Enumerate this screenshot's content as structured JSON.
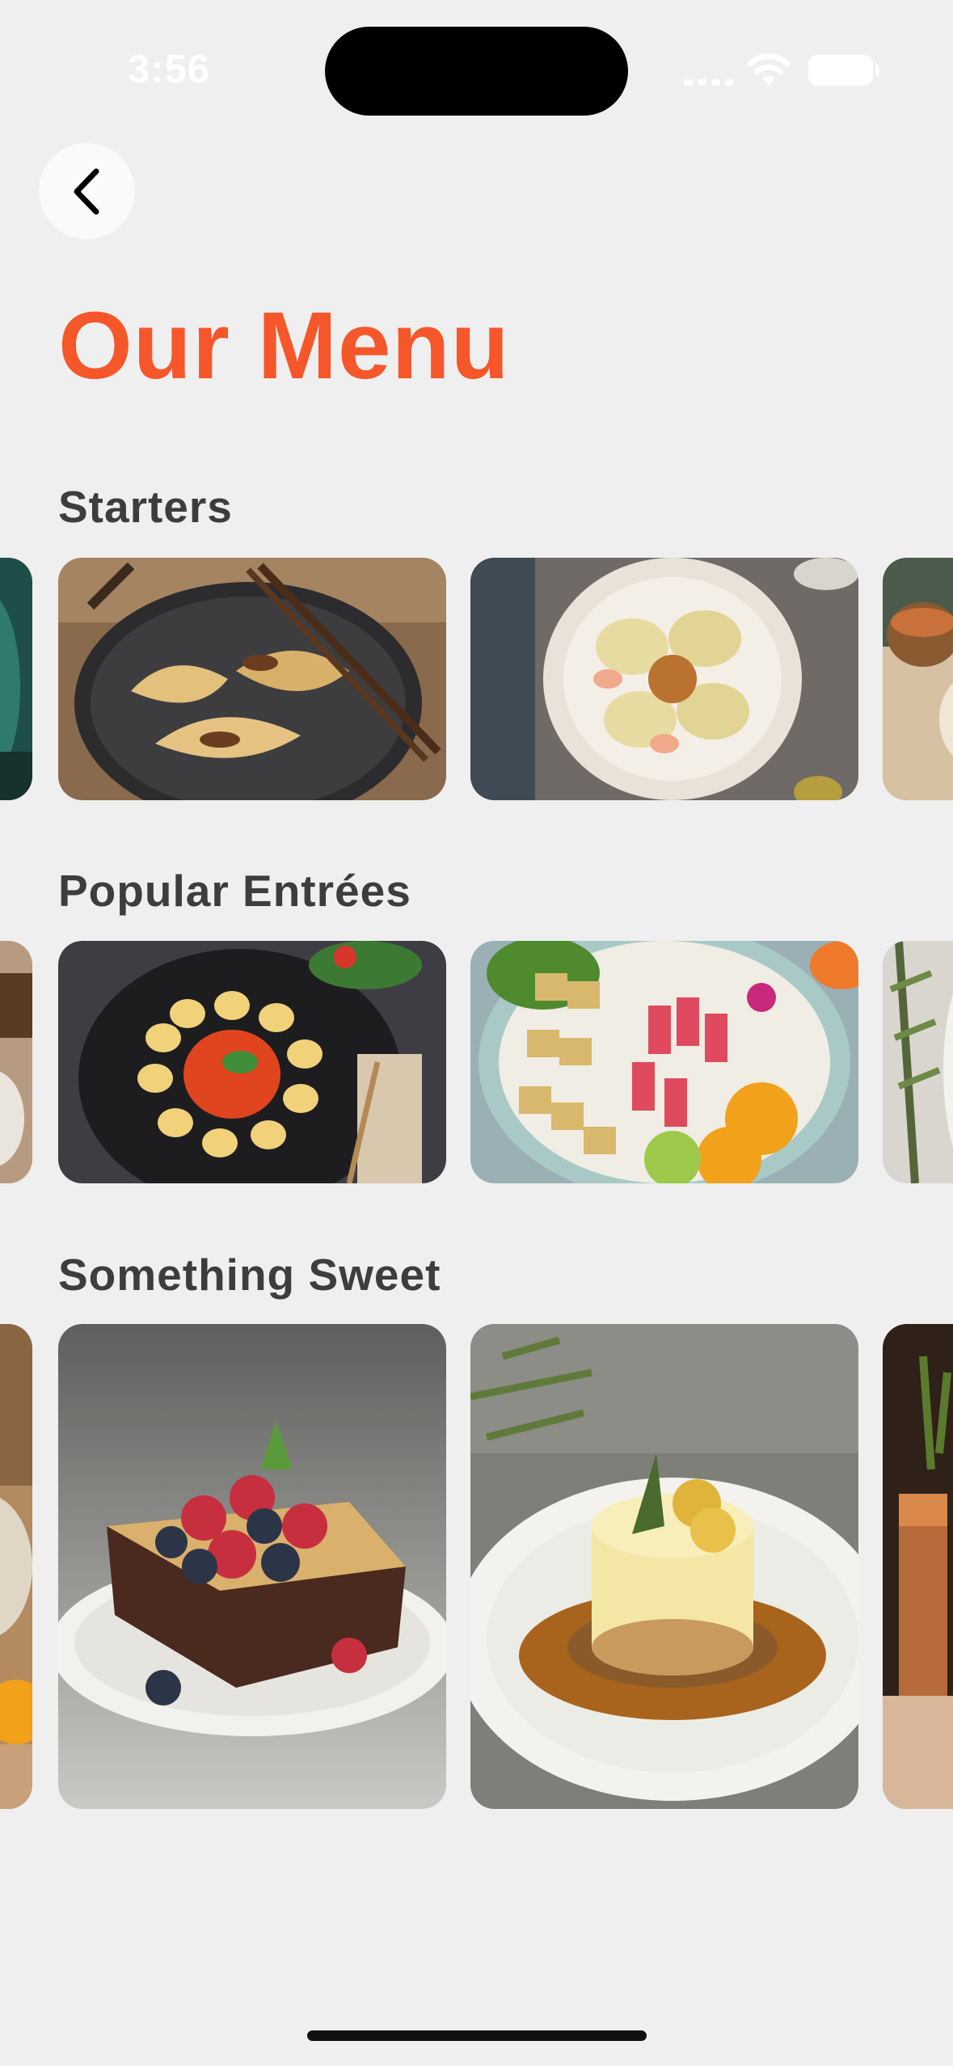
{
  "status_bar": {
    "time": "3:56"
  },
  "header": {
    "title": "Our Menu"
  },
  "sections": [
    {
      "title": "Starters",
      "items": [
        {
          "icon": "food-photo-partial"
        },
        {
          "icon": "dumplings-photo"
        },
        {
          "icon": "ravioli-shrimp-photo"
        },
        {
          "icon": "food-photo-partial"
        }
      ]
    },
    {
      "title": "Popular Entrées",
      "items": [
        {
          "icon": "food-photo-partial"
        },
        {
          "icon": "gnocchi-photo"
        },
        {
          "icon": "poke-bowl-photo"
        },
        {
          "icon": "food-photo-partial"
        }
      ]
    },
    {
      "title": "Something Sweet",
      "items": [
        {
          "icon": "dessert-photo-partial"
        },
        {
          "icon": "brownie-berries-photo"
        },
        {
          "icon": "cheesecake-photo"
        },
        {
          "icon": "drink-photo-partial"
        }
      ]
    }
  ],
  "colors": {
    "accent": "#f5572a",
    "background": "#efefef"
  }
}
